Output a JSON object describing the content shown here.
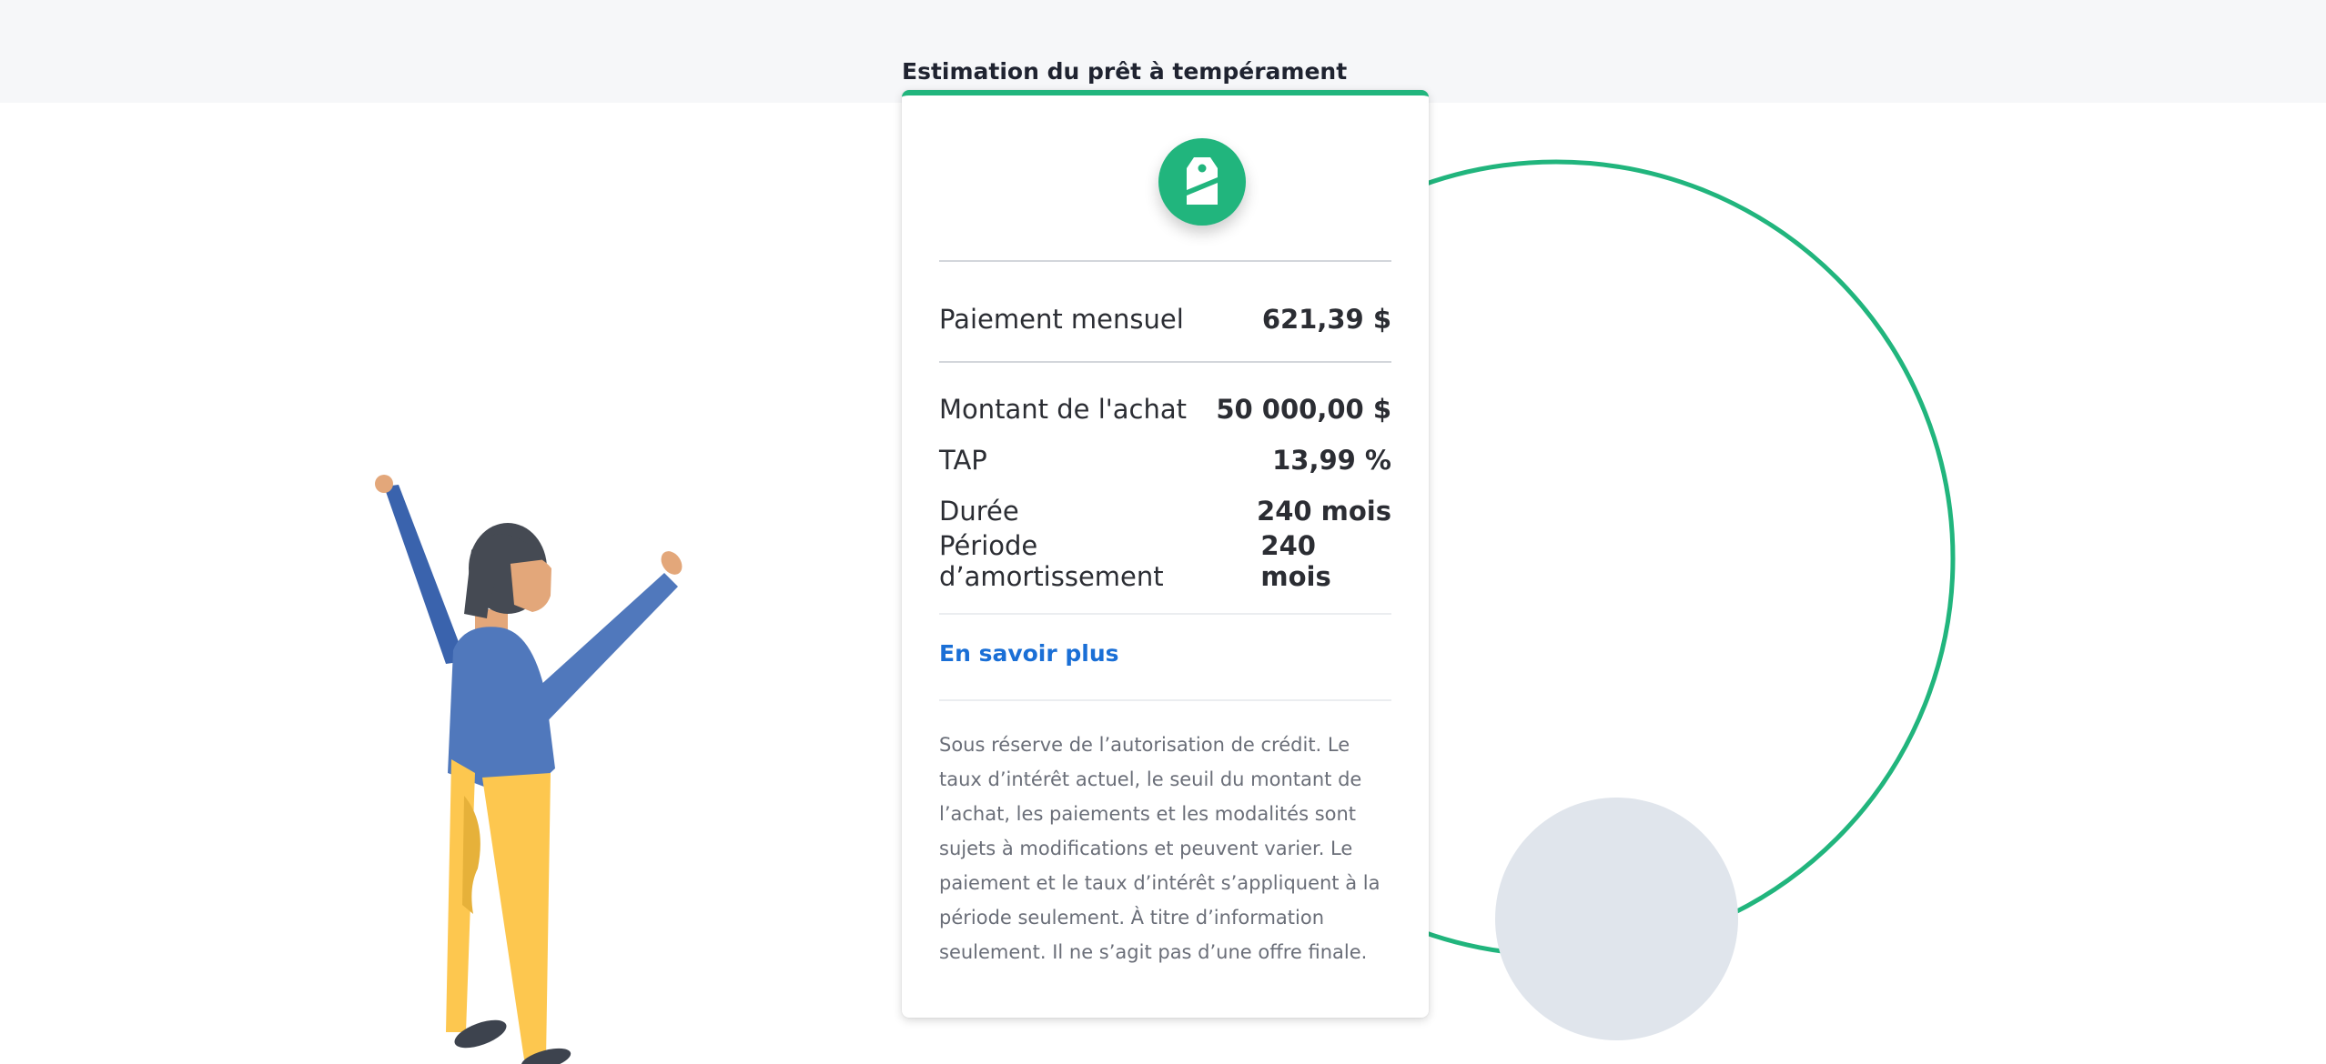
{
  "card": {
    "heading": "Estimation du prêt à tempérament",
    "badge_icon": "price-tag-icon",
    "accent_color": "#21b57d",
    "monthly_payment": {
      "label": "Paiement mensuel",
      "value": "621,39 $"
    },
    "details": [
      {
        "label": "Montant de l'achat",
        "value": "50 000,00 $"
      },
      {
        "label": "TAP",
        "value": "13,99 %"
      },
      {
        "label": "Durée",
        "value": "240 mois"
      },
      {
        "label": "Période d’amortissement",
        "value": "240 mois"
      }
    ],
    "learn_more": "En savoir plus",
    "disclaimer": "Sous réserve de l’autorisation de crédit. Le taux d’intérêt actuel, le seuil du montant de l’achat, les paiements et les modalités sont sujets à modifications et peuvent varier. Le paiement et le taux d’intérêt s’appliquent à la période seulement. À titre d’information seulement. Il ne s’agit pas d’une offre finale."
  },
  "link_color": "#1a6fd6",
  "illustration": "person-celebrating-illustration"
}
